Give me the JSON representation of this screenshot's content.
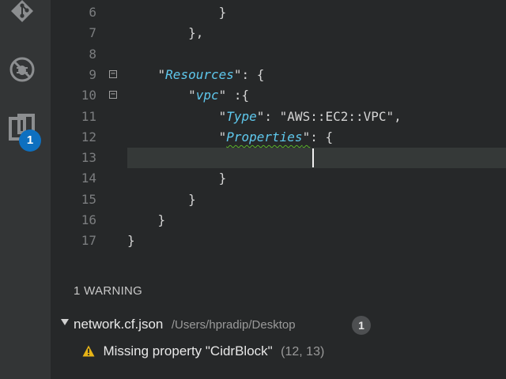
{
  "activity_bar": {
    "icons": [
      "git-icon",
      "debug-icon",
      "extensions-icon"
    ],
    "badge": "1",
    "badge_color": "#0e70c0"
  },
  "editor": {
    "lines": [
      {
        "num": "6",
        "code": [
          {
            "t": "            }",
            "c": "p"
          }
        ]
      },
      {
        "num": "7",
        "code": [
          {
            "t": "        },",
            "c": "p"
          }
        ]
      },
      {
        "num": "8",
        "code": []
      },
      {
        "num": "9",
        "fold": true,
        "code": [
          {
            "t": "    ",
            "c": "p"
          },
          {
            "t": "\"",
            "c": "p"
          },
          {
            "t": "Resources",
            "c": "k"
          },
          {
            "t": "\": {",
            "c": "p"
          }
        ]
      },
      {
        "num": "10",
        "fold": true,
        "code": [
          {
            "t": "        ",
            "c": "p"
          },
          {
            "t": "\"",
            "c": "p"
          },
          {
            "t": "vpc",
            "c": "k"
          },
          {
            "t": "\" :{",
            "c": "p"
          }
        ]
      },
      {
        "num": "11",
        "code": [
          {
            "t": "            ",
            "c": "p"
          },
          {
            "t": "\"",
            "c": "p"
          },
          {
            "t": "Type",
            "c": "k"
          },
          {
            "t": "\": \"AWS::EC2::VPC\",",
            "c": "p"
          }
        ]
      },
      {
        "num": "12",
        "code": [
          {
            "t": "            ",
            "c": "p"
          },
          {
            "t": "\"",
            "c": "p"
          },
          {
            "t": "Properties",
            "c": "ks"
          },
          {
            "t": "\"",
            "c": "ps"
          },
          {
            "t": ": {",
            "c": "p"
          }
        ]
      },
      {
        "num": "13",
        "code": []
      },
      {
        "num": "14",
        "code": [
          {
            "t": "            }",
            "c": "p"
          }
        ]
      },
      {
        "num": "15",
        "code": [
          {
            "t": "        }",
            "c": "p"
          }
        ]
      },
      {
        "num": "16",
        "code": [
          {
            "t": "    }",
            "c": "p"
          }
        ]
      },
      {
        "num": "17",
        "code": [
          {
            "t": "}",
            "c": "p"
          }
        ]
      }
    ],
    "current_line": "13",
    "key_color": "#5fc9ee",
    "warning_underline_color": "#5bb52a"
  },
  "problems": {
    "title": "1 WARNING",
    "file_name": "network.cf.json",
    "file_path": "/Users/hpradip/Desktop",
    "count": "1",
    "warning_message": "Missing property \"CidrBlock\"",
    "warning_position": "(12, 13)",
    "warning_color": "#e7b416"
  }
}
